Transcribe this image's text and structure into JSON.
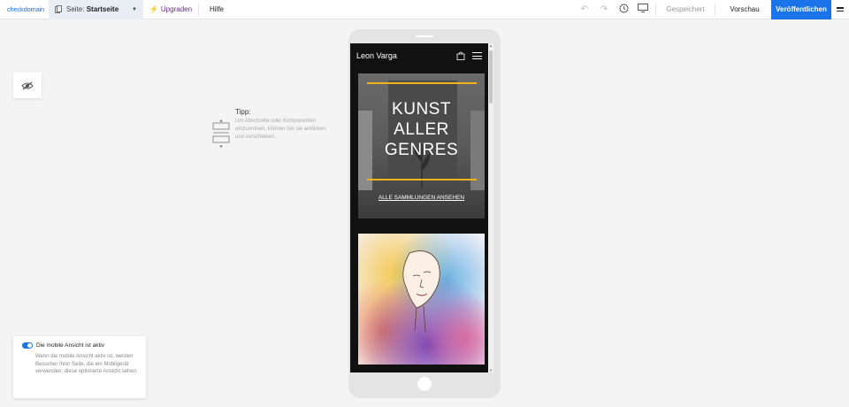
{
  "topbar": {
    "logo": "checkdomain",
    "page_select": {
      "prefix": "Seite:",
      "value": "Startseite"
    },
    "upgrade_label": "Upgraden",
    "help_label": "Hilfe",
    "saved_label": "Gespeichert",
    "preview_label": "Vorschau",
    "publish_label": "Veröffentlichen"
  },
  "tip": {
    "title": "Tipp:",
    "text": "Um Abschnitte oder Komponenten umzuordnen, können Sie sie anklicken und verschieben."
  },
  "mobile_notice": {
    "title": "Die mobile Ansicht ist aktiv",
    "text": "Wenn die mobile Ansicht aktiv ist, werden Besucher Ihrer Seite, die ein Mobilgerät verwenden, diese optimierte Ansicht sehen.",
    "enabled": true
  },
  "phone": {
    "brand": "Leon Varga",
    "hero": {
      "line1": "KUNST",
      "line2": "ALLER",
      "line3": "GENRES",
      "link": "ALLE SAMMLUNGEN ANSEHEN"
    }
  },
  "colors": {
    "accent": "#1a73e8",
    "upgrade": "#6a2a8a",
    "hero_bar": "#f0b020"
  }
}
